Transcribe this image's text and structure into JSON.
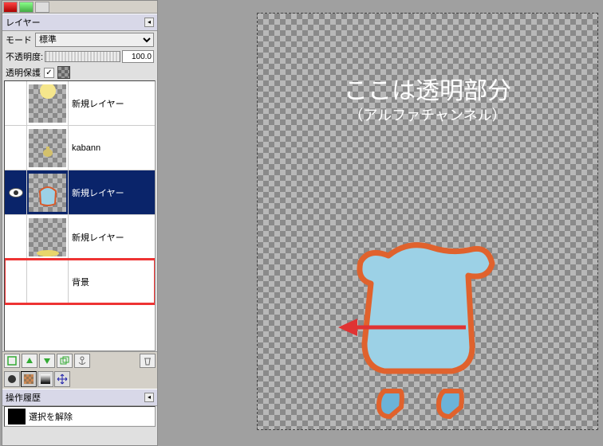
{
  "layers_panel": {
    "title": "レイヤー",
    "mode_label": "モード",
    "mode_value": "標準",
    "opacity_label": "不透明度:",
    "opacity_value": "100.0",
    "alpha_lock_label": "透明保護",
    "alpha_lock_checked": "✓"
  },
  "layers": [
    {
      "name": "新規レイヤー",
      "selected": false,
      "thumb": "checker",
      "eye": false
    },
    {
      "name": "kabann",
      "selected": false,
      "thumb": "checker",
      "eye": false
    },
    {
      "name": "新規レイヤー",
      "selected": true,
      "thumb": "checker",
      "eye": true
    },
    {
      "name": "新規レイヤー",
      "selected": false,
      "thumb": "checker",
      "eye": false
    },
    {
      "name": "背景",
      "selected": false,
      "thumb": "white",
      "eye": false,
      "highlighted": true
    }
  ],
  "history_panel": {
    "title": "操作履歴",
    "item": "選択を解除"
  },
  "annotations": {
    "line1": "ここは透明部分",
    "line2": "（アルファチャンネル）"
  },
  "icons": {
    "new": "□",
    "up": "↑",
    "down": "↓",
    "dup": "⧉",
    "anchor": "⚓",
    "trash": "🗑"
  }
}
